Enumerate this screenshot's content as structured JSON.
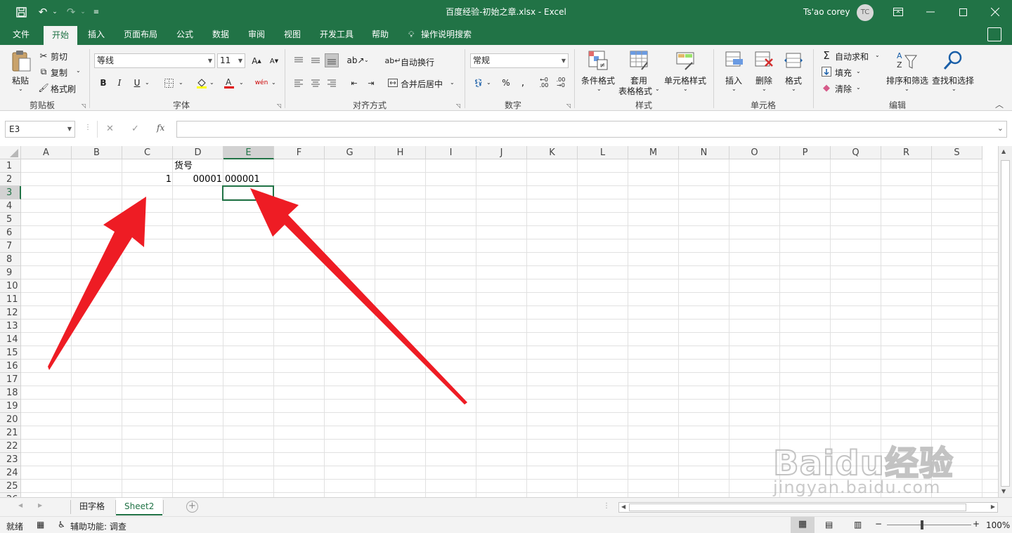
{
  "window": {
    "title": "百度经验-初始之章.xlsx  -  Excel",
    "user_name": "Ts'ao corey",
    "user_initials": "TC",
    "accent_color": "#217346"
  },
  "tabs": [
    "文件",
    "开始",
    "插入",
    "页面布局",
    "公式",
    "数据",
    "审阅",
    "视图",
    "开发工具",
    "帮助"
  ],
  "active_tab": "开始",
  "tell_me": "操作说明搜索",
  "ribbon": {
    "clipboard": {
      "paste": "粘贴",
      "cut": "剪切",
      "copy": "复制",
      "format_painter": "格式刷",
      "label": "剪贴板"
    },
    "font": {
      "font_name": "等线",
      "font_size": "11",
      "bold": "B",
      "italic": "I",
      "underline": "U",
      "label": "字体"
    },
    "alignment": {
      "wrap_text": "自动换行",
      "merge_center": "合并后居中",
      "label": "对齐方式"
    },
    "number": {
      "format": "常规",
      "label": "数字"
    },
    "styles": {
      "conditional": "条件格式",
      "table_line1": "套用",
      "table_line2": "表格格式",
      "cell_styles": "单元格样式",
      "label": "样式"
    },
    "cells": {
      "insert": "插入",
      "delete": "删除",
      "format": "格式",
      "label": "单元格"
    },
    "editing": {
      "autosum": "自动求和",
      "fill": "填充",
      "clear": "清除",
      "sort_filter": "排序和筛选",
      "find_select": "查找和选择",
      "label": "编辑"
    }
  },
  "formula_bar": {
    "name_box": "E3",
    "fx": "fx",
    "content": ""
  },
  "columns": [
    "A",
    "B",
    "C",
    "D",
    "E",
    "F",
    "G",
    "H",
    "I",
    "J",
    "K",
    "L",
    "M",
    "N",
    "O",
    "P",
    "Q",
    "R",
    "S"
  ],
  "rows": [
    "1",
    "2",
    "3",
    "4",
    "5",
    "6",
    "7",
    "8",
    "9",
    "10",
    "11",
    "12",
    "13",
    "14",
    "15",
    "16",
    "17",
    "18",
    "19",
    "20",
    "21",
    "22",
    "23",
    "24",
    "25",
    "26"
  ],
  "cells": {
    "D1": "货号",
    "C2": "1",
    "D2": "00001",
    "E2": "000001"
  },
  "selected_cell": "E3",
  "sheets": [
    "田字格",
    "Sheet2"
  ],
  "active_sheet": "Sheet2",
  "status": {
    "ready": "就绪",
    "accessibility": "辅助功能: 调查",
    "zoom": "100%"
  },
  "watermark": {
    "brand": "Baidu经验",
    "url": "jingyan.baidu.com"
  },
  "colors": {
    "arrow": "#ee1c24",
    "grid_line": "#e1e1e1"
  }
}
